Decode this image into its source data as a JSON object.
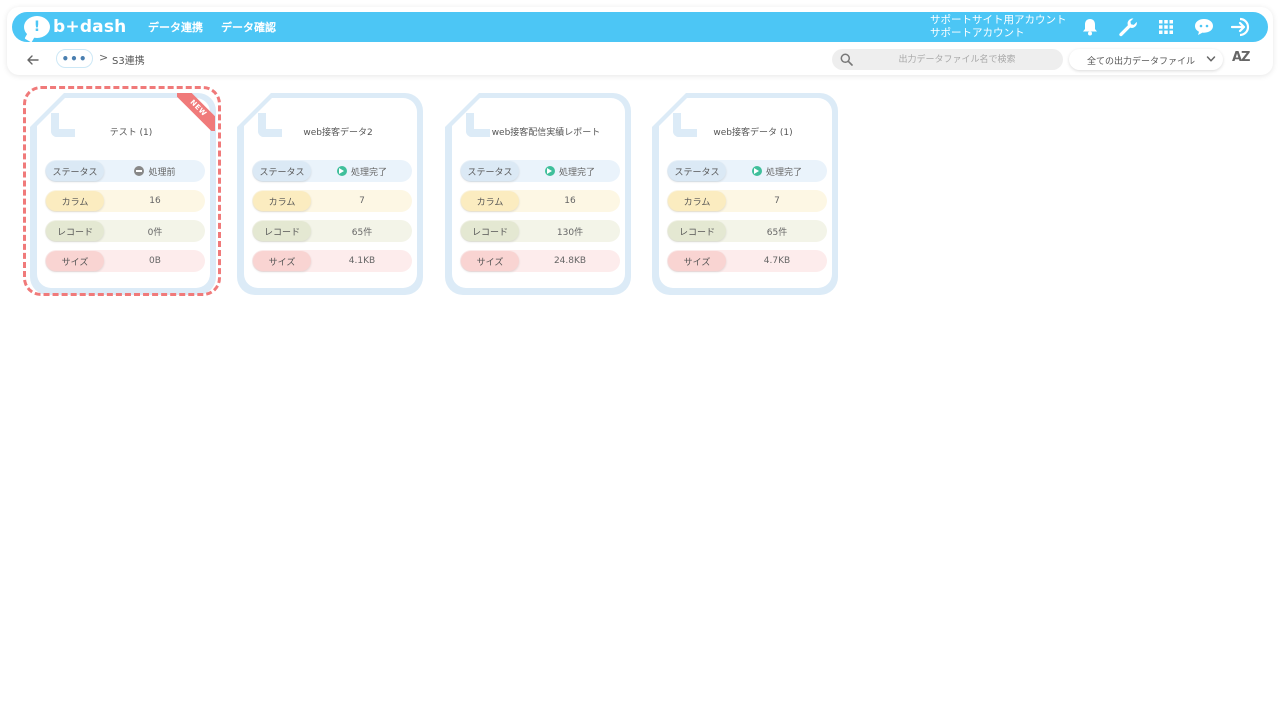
{
  "app": {
    "logo_mark": "!",
    "logo_text": "b+dash"
  },
  "nav": {
    "items": [
      {
        "label": "データ連携"
      },
      {
        "label": "データ確認"
      }
    ]
  },
  "account": {
    "line1": "サポートサイト用アカウント",
    "line2": "サポートアカウント"
  },
  "top_icons": [
    "bell-icon",
    "wrench-icon",
    "apps-grid-icon",
    "ai-chat-icon",
    "logout-icon"
  ],
  "breadcrumb": {
    "more": "•••",
    "separator": ">",
    "current": "S3連携"
  },
  "search": {
    "placeholder": "出力データファイル名で検索",
    "value": ""
  },
  "filter": {
    "selected": "全ての出力データファイル"
  },
  "sort": {
    "label": "AZ"
  },
  "labels": {
    "status": "ステータス",
    "columns": "カラム",
    "records": "レコード",
    "size": "サイズ"
  },
  "colors": {
    "header": "#4cc6f5",
    "selected_outline": "#f07a7a",
    "status_done": "#3fbf9b",
    "status_pending": "#888888"
  },
  "cards": [
    {
      "title": "テスト (1)",
      "badge": "NEW",
      "status": "処理前",
      "status_type": "pending",
      "columns": "16",
      "records": "0件",
      "size": "0B"
    },
    {
      "title": "web接客データ2",
      "status": "処理完了",
      "status_type": "done",
      "columns": "7",
      "records": "65件",
      "size": "4.1KB"
    },
    {
      "title": "web接客配信実績レポート",
      "status": "処理完了",
      "status_type": "done",
      "columns": "16",
      "records": "130件",
      "size": "24.8KB"
    },
    {
      "title": "web接客データ (1)",
      "status": "処理完了",
      "status_type": "done",
      "columns": "7",
      "records": "65件",
      "size": "4.7KB"
    }
  ]
}
